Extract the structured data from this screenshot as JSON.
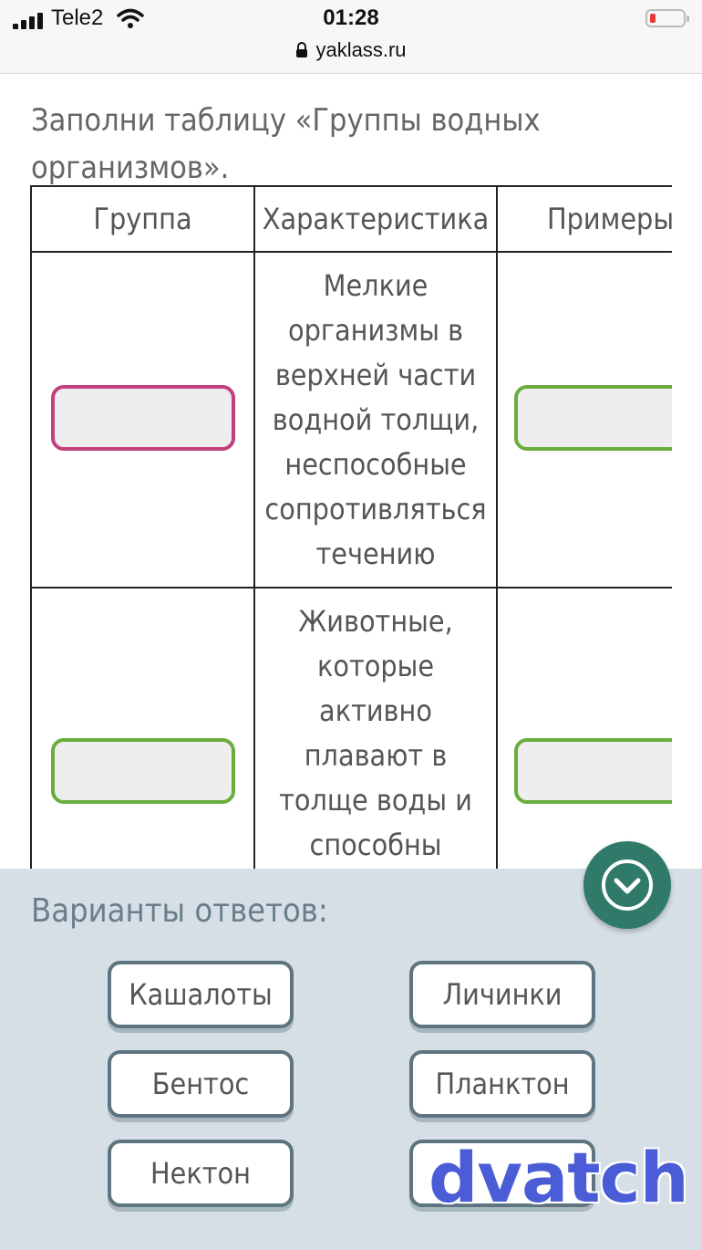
{
  "status_bar": {
    "carrier": "Tele2",
    "time": "01:28",
    "url": "yaklass.ru"
  },
  "question": "Заполни таблицу «Группы водных организмов».",
  "table": {
    "headers": [
      "Группа",
      "Характеристика",
      "Примеры"
    ],
    "rows": [
      {
        "description": "Мелкие организмы в верхней части водной толщи, неспособные сопротивляться течению"
      },
      {
        "description": "Животные, которые активно плавают в толще воды и способны"
      }
    ]
  },
  "answers_panel": {
    "title": "Варианты ответов:",
    "options": [
      "Кашалоты",
      "Личинки",
      "Бентос",
      "Планктон",
      "Нектон",
      ""
    ]
  },
  "watermark": "dvatch",
  "colors": {
    "slot_active": "#c2407e",
    "slot_default": "#6aad3c",
    "panel_bg": "#d6dfe6",
    "fab": "#2f7a69"
  }
}
